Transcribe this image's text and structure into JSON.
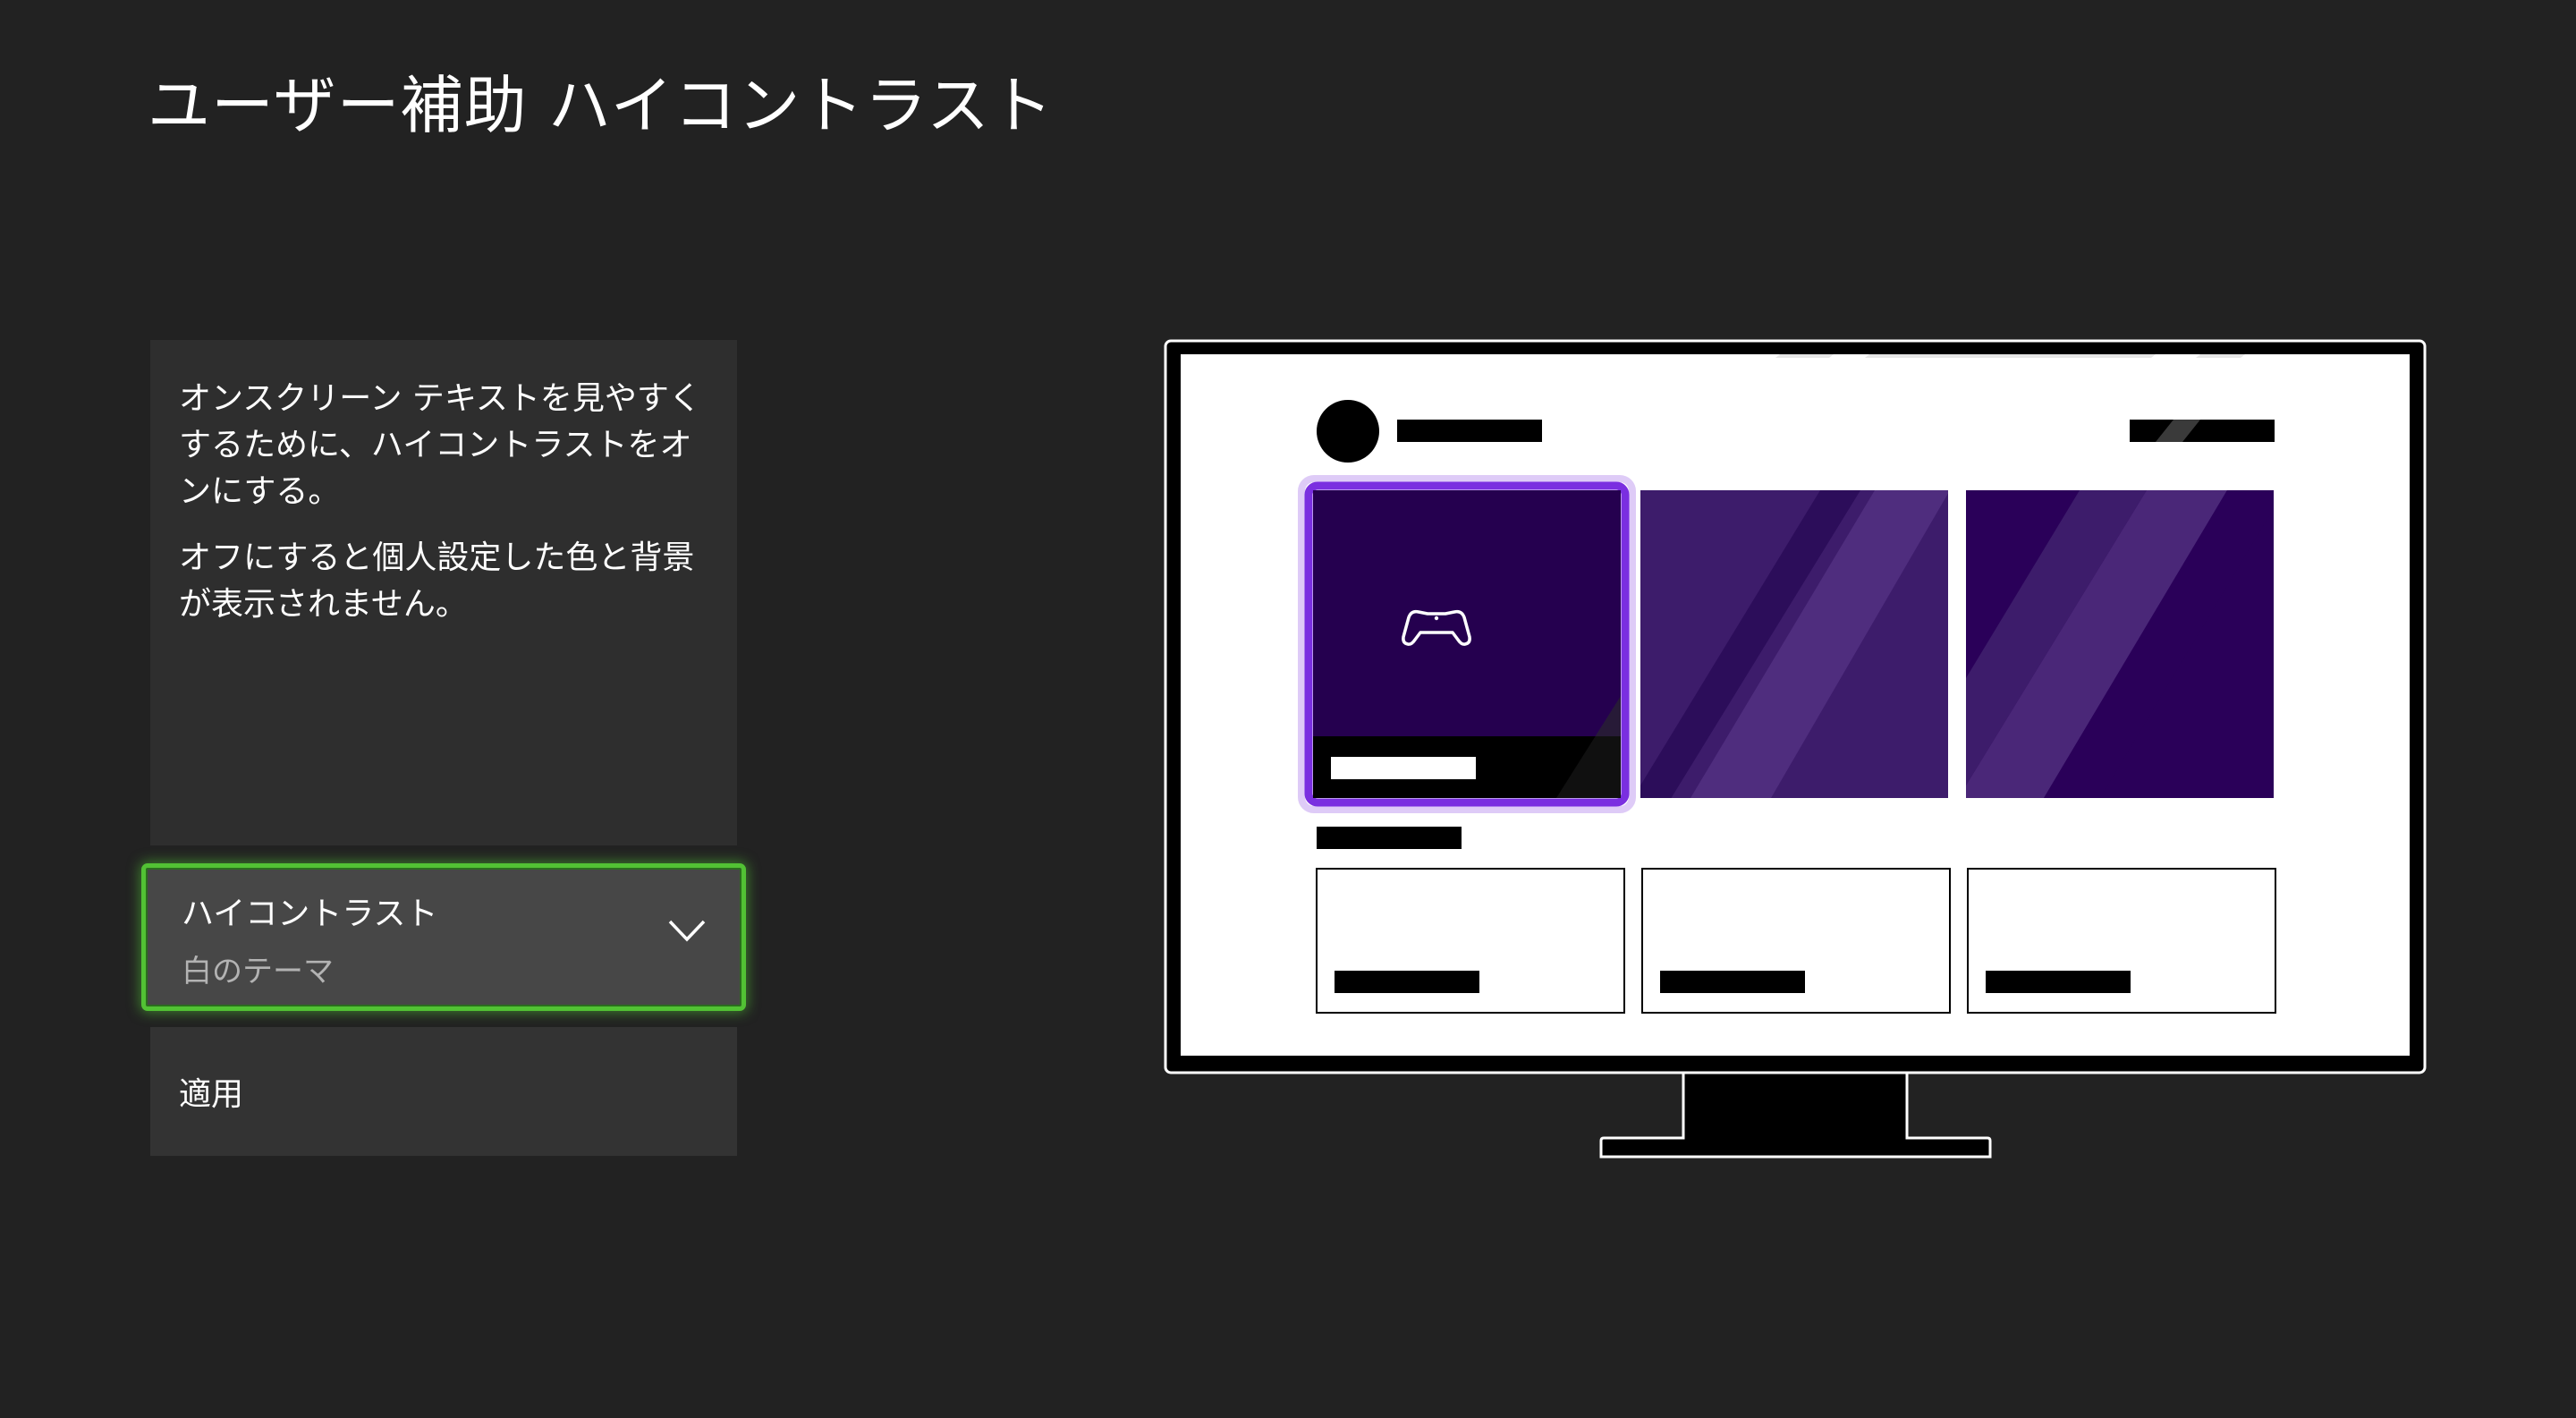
{
  "header": {
    "title": "ユーザー補助  ハイコントラスト"
  },
  "description": {
    "paragraph_1": "オンスクリーン テキストを見やすくするために、ハイコントラストをオンにする。",
    "paragraph_2": "オフにすると個人設定した色と背景が表示されません。"
  },
  "dropdown": {
    "label": "ハイコントラスト",
    "selected_value": "白のテーマ",
    "icon": "chevron-down-icon"
  },
  "apply_button": {
    "label": "適用"
  },
  "preview": {
    "icon": "controller-icon",
    "colors": {
      "background": "#222222",
      "screen": "#ffffff",
      "tile_selected": "#25004f",
      "tile": "#3d1c6b",
      "focus": "#7a2fe0",
      "dropdown_focus": "#52c234"
    }
  }
}
